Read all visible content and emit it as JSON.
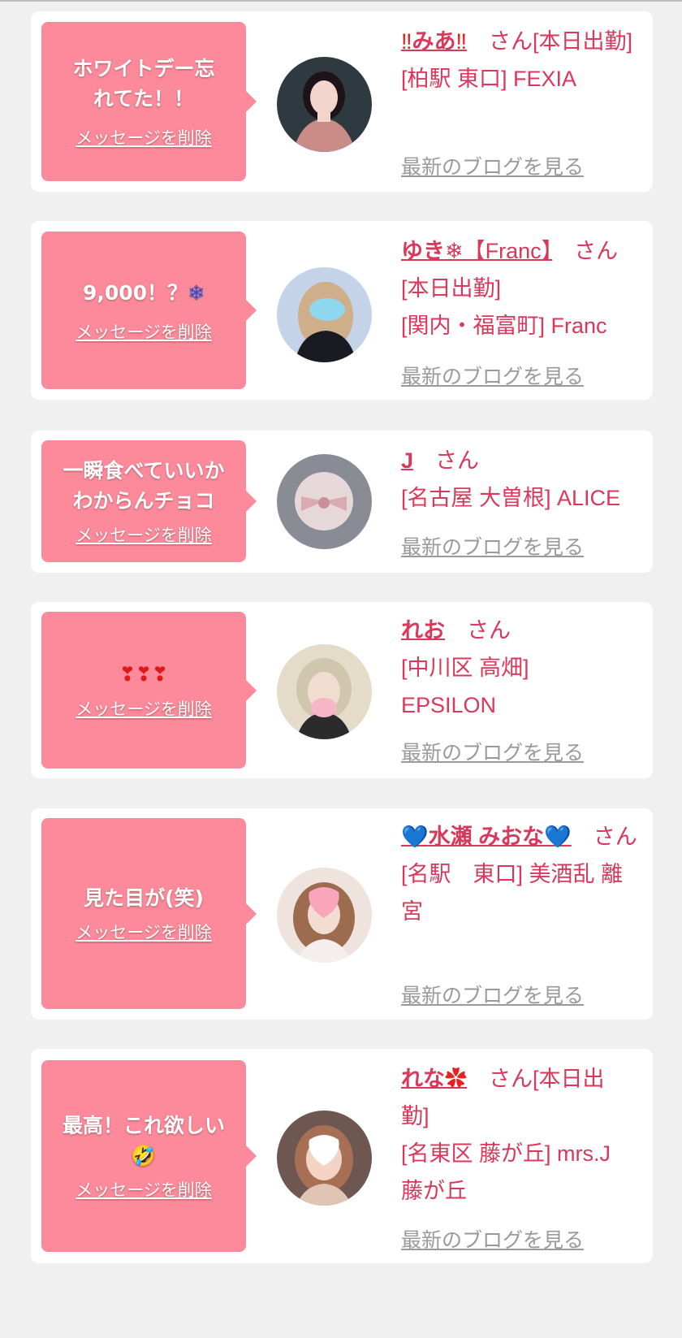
{
  "delete_label": "メッセージを削除",
  "blog_label": "最新のブログを見る",
  "san_label": "さん",
  "colors": {
    "bubble": "#fd8a9a",
    "name": "#d9385b",
    "link_gray": "#9a9a9a",
    "background": "#f0f0f0"
  },
  "items": [
    {
      "message": "ホワイトデー忘れてた！！",
      "name_prefix": "‼",
      "name": "みあ",
      "name_suffix": "‼",
      "status": "[本日出勤]",
      "store": "[柏駅 東口] FEXIA"
    },
    {
      "message": "9,000！？",
      "message_emoji": "❄",
      "name_prefix": "",
      "name": "ゆき",
      "name_suffix": "❄【Franc】",
      "status": "[本日出勤]",
      "store": "[関内・福富町] Franc"
    },
    {
      "message": "一瞬食べていいかわからんチョコ",
      "name_prefix": "",
      "name": "J",
      "name_suffix": "",
      "status": "",
      "store": "[名古屋 大曽根] ALICE"
    },
    {
      "message": "❣❣❣",
      "name_prefix": "",
      "name": "れお",
      "name_suffix": "",
      "status": "",
      "store": "[中川区 高畑] EPSILON"
    },
    {
      "message": "見た目が(笑)",
      "name_prefix": "💙",
      "name": "水瀬 みおな",
      "name_suffix": "💙",
      "status": "",
      "store": "[名駅　東口] 美酒乱 離宮"
    },
    {
      "message": "最高！これ欲しい",
      "message_emoji": "🤣",
      "name_prefix": "",
      "name": "れな",
      "name_suffix": "✿",
      "status": "[本日出勤]",
      "store": "[名東区 藤が丘] mrs.J 藤が丘"
    }
  ]
}
